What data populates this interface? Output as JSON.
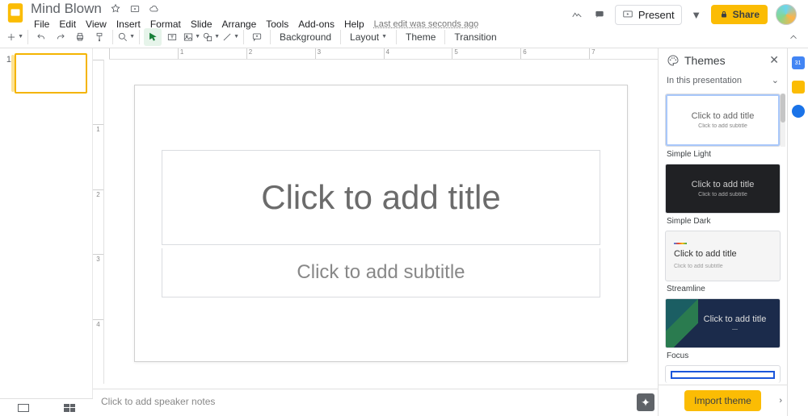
{
  "doc_title": "Mind Blown",
  "last_edit": "Last edit was seconds ago",
  "menus": [
    "File",
    "Edit",
    "View",
    "Insert",
    "Format",
    "Slide",
    "Arrange",
    "Tools",
    "Add-ons",
    "Help"
  ],
  "header_buttons": {
    "present": "Present",
    "share": "Share"
  },
  "toolbar": {
    "background": "Background",
    "layout": "Layout",
    "theme": "Theme",
    "transition": "Transition"
  },
  "ruler_h": [
    "",
    "1",
    "2",
    "3",
    "4",
    "5",
    "6",
    "7"
  ],
  "ruler_v": [
    "",
    "1",
    "2",
    "3",
    "4"
  ],
  "slide": {
    "title_placeholder": "Click to add title",
    "subtitle_placeholder": "Click to add subtitle"
  },
  "filmstrip": {
    "current": "1"
  },
  "speaker_notes_placeholder": "Click to add speaker notes",
  "themes_panel": {
    "title": "Themes",
    "section": "In this presentation",
    "card_title": "Click to add title",
    "card_sub": "Click to add subtitle",
    "items": [
      {
        "label": "Simple Light"
      },
      {
        "label": "Simple Dark"
      },
      {
        "label": "Streamline"
      },
      {
        "label": "Focus"
      }
    ],
    "import": "Import theme"
  }
}
